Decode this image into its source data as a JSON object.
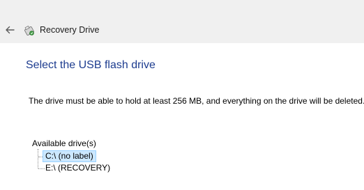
{
  "titlebar": {
    "back_icon": "back-arrow-icon",
    "app_icon": "recovery-drive-icon",
    "title": "Recovery Drive"
  },
  "main": {
    "heading": "Select the USB flash drive",
    "description": "The drive must be able to hold at least 256 MB, and everything on the drive will be deleted.",
    "drives_label": "Available drive(s)",
    "drives": [
      {
        "label": "C:\\ (no label)",
        "selected": true
      },
      {
        "label": "E:\\ (RECOVERY)",
        "selected": false
      }
    ]
  },
  "colors": {
    "heading": "#1d3c8f",
    "titlebar_bg": "#f0f0f0",
    "selection_bg": "#cce8ff",
    "selection_border": "#99d1ff"
  }
}
